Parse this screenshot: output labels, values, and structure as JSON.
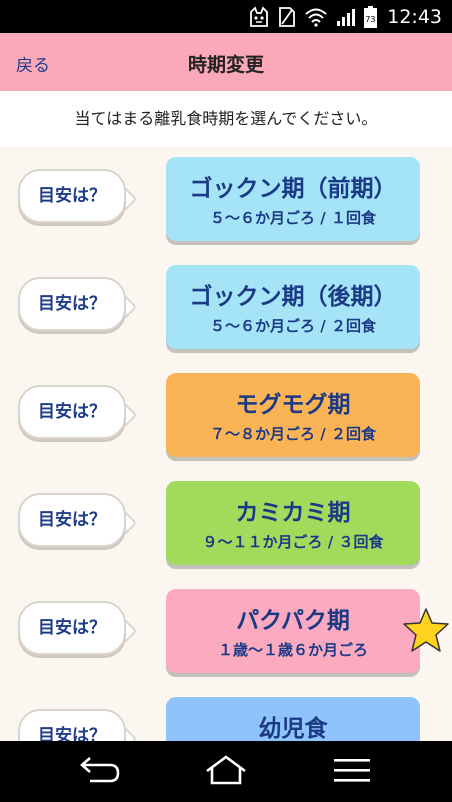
{
  "status_bar": {
    "time": "12:43",
    "battery_level": "73",
    "icons": [
      "cat-notification-icon",
      "sim-no-signal-icon",
      "wifi-icon",
      "signal-bars-icon",
      "battery-icon"
    ]
  },
  "header": {
    "back_label": "戻る",
    "title": "時期変更"
  },
  "instruction": "当てはまる離乳食時期を選んでください。",
  "hint_label": "目安は？",
  "stages": [
    {
      "name": "ゴックン期（前期）",
      "sub": "５～６か月ごろ / １回食",
      "color": "#a5e3f6"
    },
    {
      "name": "ゴックン期（後期）",
      "sub": "５～６か月ごろ / ２回食",
      "color": "#a5e3f6"
    },
    {
      "name": "モグモグ期",
      "sub": "７～８か月ごろ / ２回食",
      "color": "#fbb455"
    },
    {
      "name": "カミカミ期",
      "sub": "９～１１か月ごろ / ３回食",
      "color": "#a2db5c"
    },
    {
      "name": "パクパク期",
      "sub": "１歳～１歳６か月ごろ",
      "color": "#fbaac0",
      "starred": true
    },
    {
      "name": "幼児食",
      "sub": "",
      "color": "#8ec4fb"
    }
  ],
  "colors": {
    "header_bg": "#fba8b9",
    "page_bg": "#fbf6ef",
    "text_blue": "#1b3a85",
    "star": "#ffd21f"
  },
  "navbar": {
    "icons": [
      "back-icon",
      "home-icon",
      "menu-icon"
    ]
  }
}
